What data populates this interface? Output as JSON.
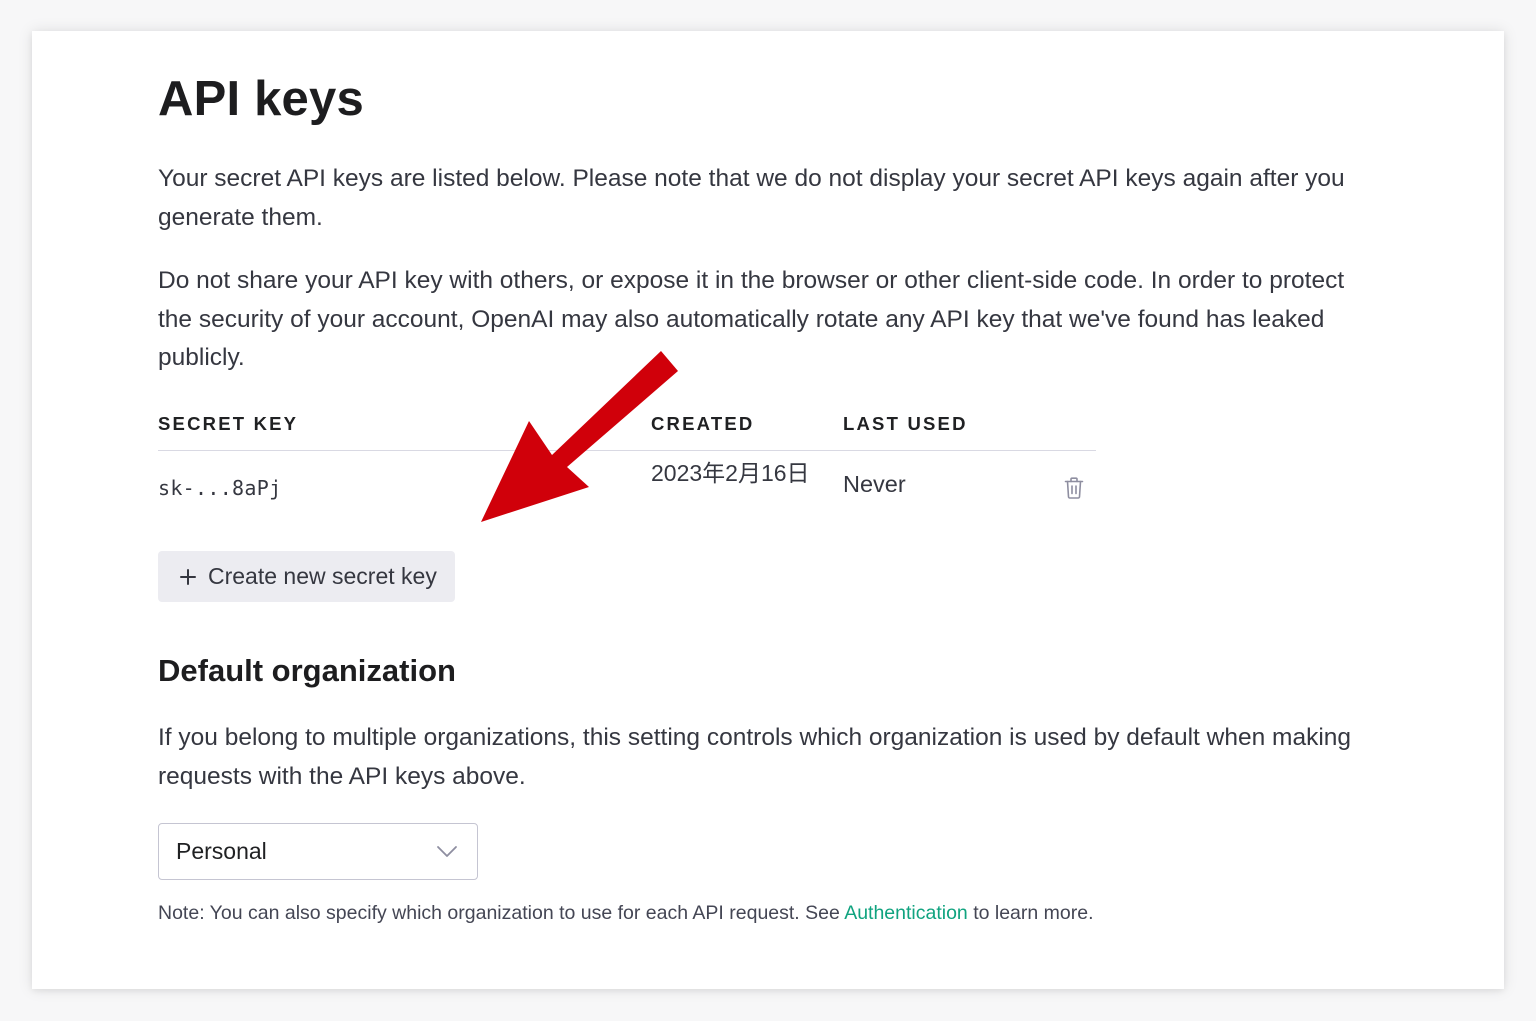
{
  "page": {
    "title": "API keys",
    "intro_1": "Your secret API keys are listed below. Please note that we do not display your secret API keys again after you generate them.",
    "intro_2": "Do not share your API key with others, or expose it in the browser or other client-side code. In order to protect the security of your account, OpenAI may also automatically rotate any API key that we've found has leaked publicly."
  },
  "keys_table": {
    "columns": [
      "SECRET KEY",
      "CREATED",
      "LAST USED"
    ],
    "rows": [
      {
        "key": "sk-...8aPj",
        "created": "2023年2月16日",
        "last_used": "Never",
        "delete_icon": "trash-icon"
      }
    ]
  },
  "create_button": {
    "icon": "plus-icon",
    "label": "Create new secret key"
  },
  "default_org": {
    "title": "Default organization",
    "description": "If you belong to multiple organizations, this setting controls which organization is used by default when making requests with the API keys above.",
    "selected": "Personal",
    "note_before": "Note: You can also specify which organization to use for each API request. See ",
    "note_link": "Authentication",
    "note_after": " to learn more."
  },
  "colors": {
    "link": "#10a37f",
    "button_bg": "#ececf1",
    "annotation_arrow": "#d0000a"
  }
}
